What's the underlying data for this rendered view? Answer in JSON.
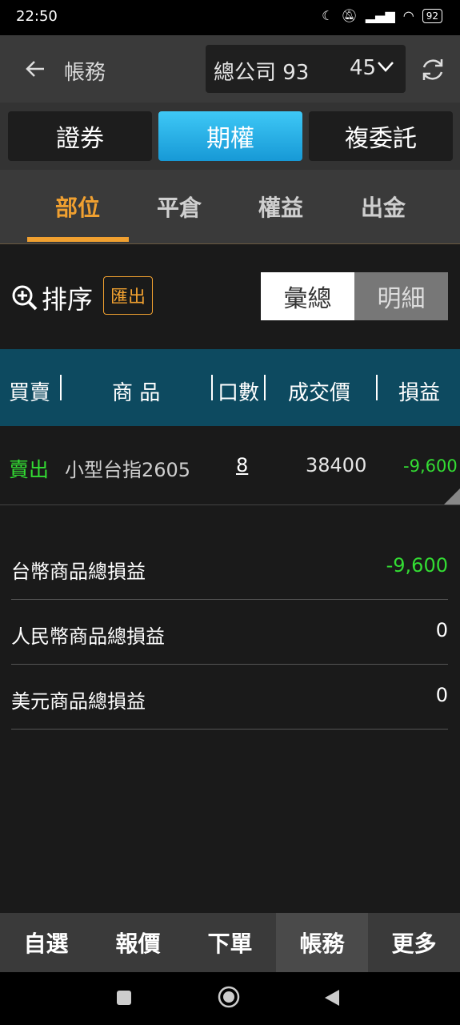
{
  "status_bar": {
    "time": "22:50",
    "battery": "92"
  },
  "header": {
    "title": "帳務",
    "account_prefix": "總公司 93",
    "account_suffix": "45"
  },
  "product_tabs": [
    {
      "label": "證券"
    },
    {
      "label": "期權"
    },
    {
      "label": "複委託"
    }
  ],
  "sub_tabs": [
    {
      "label": "部位"
    },
    {
      "label": "平倉"
    },
    {
      "label": "權益"
    },
    {
      "label": "出金"
    }
  ],
  "toolbar": {
    "sort_label": "排序",
    "export_label": "匯出",
    "view_summary": "彙總",
    "view_detail": "明細"
  },
  "table": {
    "headers": {
      "side": "買賣",
      "product": "商 品",
      "qty": "口數",
      "price": "成交價",
      "pnl": "損益"
    },
    "rows": [
      {
        "side": "賣出",
        "product": "小型台指2605",
        "qty": "8",
        "price": "38400",
        "pnl": "-9,600"
      }
    ]
  },
  "summary": [
    {
      "label": "台幣商品總損益",
      "value": "-9,600"
    },
    {
      "label": "人民幣商品總損益",
      "value": "0"
    },
    {
      "label": "美元商品總損益",
      "value": "0"
    }
  ],
  "bottom_nav": [
    {
      "label": "自選"
    },
    {
      "label": "報價"
    },
    {
      "label": "下單"
    },
    {
      "label": "帳務"
    },
    {
      "label": "更多"
    }
  ],
  "colors": {
    "accent": "#f0a030",
    "active_tab": "#1fa8e6",
    "loss": "#33dd33",
    "header_bg": "#0d4a60"
  }
}
